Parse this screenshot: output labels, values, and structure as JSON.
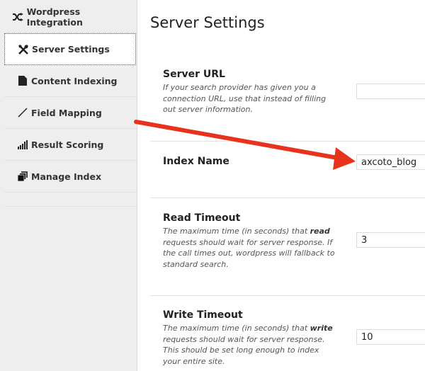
{
  "sidebar": {
    "items": [
      {
        "label": "Wordpress Integration",
        "icon": "shuffle-icon"
      },
      {
        "label": "Server Settings",
        "icon": "wrench-icon",
        "active": true
      },
      {
        "label": "Content Indexing",
        "icon": "file-icon"
      },
      {
        "label": "Field Mapping",
        "icon": "line-icon"
      },
      {
        "label": "Result Scoring",
        "icon": "signal-bars-icon"
      },
      {
        "label": "Manage Index",
        "icon": "stack-icon"
      }
    ]
  },
  "main": {
    "title": "Server Settings",
    "fields": [
      {
        "label": "Server URL",
        "desc": "If your search provider has given you a connection URL, use that instead of filling out server information.",
        "value": ""
      },
      {
        "label": "Index Name",
        "value": "axcoto_blog"
      },
      {
        "label": "Read Timeout",
        "desc_pre": "The maximum time (in seconds) that ",
        "desc_bold": "read",
        "desc_post": " requests should wait for server response. If the call times out, wordpress will fallback to standard search.",
        "value": "3"
      },
      {
        "label": "Write Timeout",
        "desc_pre": "The maximum time (in seconds) that ",
        "desc_bold": "write",
        "desc_post": " requests should wait for server response. This should be set long enough to index your entire site.",
        "value": "10"
      }
    ]
  },
  "annotation": {
    "arrow_color": "#e8321e"
  }
}
